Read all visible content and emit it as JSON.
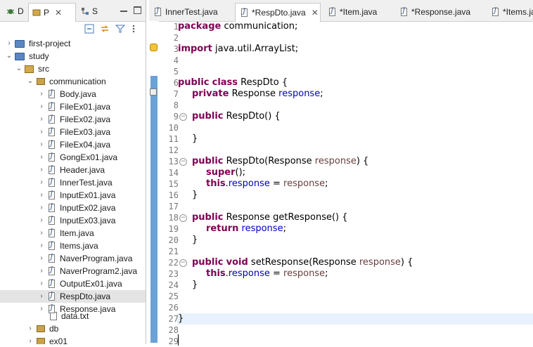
{
  "left_panel": {
    "tabs": [
      {
        "label": "D"
      },
      {
        "label": "P"
      },
      {
        "label": "S"
      }
    ],
    "tree": {
      "projects": [
        {
          "label": "first-project"
        },
        {
          "label": "study"
        }
      ],
      "src": "src",
      "package": "communication",
      "files": [
        "Body.java",
        "FileEx01.java",
        "FileEx02.java",
        "FileEx03.java",
        "FileEx04.java",
        "GongEx01.java",
        "Header.java",
        "InnerTest.java",
        "InputEx01.java",
        "InputEx02.java",
        "InputEx03.java",
        "Item.java",
        "Items.java",
        "NaverProgram.java",
        "NaverProgram2.java",
        "OutputEx01.java",
        "RespDto.java",
        "Response.java"
      ],
      "data_file": "data.txt",
      "other_packages": [
        "db",
        "ex01"
      ]
    }
  },
  "editor": {
    "tabs": [
      {
        "label": "InnerTest.java"
      },
      {
        "label": "*RespDto.java"
      },
      {
        "label": "*Item.java"
      },
      {
        "label": "*Response.java"
      },
      {
        "label": "*Items.ja"
      }
    ],
    "line_numbers": [
      "1",
      "2",
      "3",
      "4",
      "5",
      "6",
      "7",
      "8",
      "9",
      "10",
      "11",
      "12",
      "13",
      "14",
      "15",
      "16",
      "17",
      "18",
      "19",
      "20",
      "21",
      "22",
      "23",
      "24",
      "25",
      "26",
      "27",
      "28",
      "29"
    ]
  },
  "colors": {
    "keyword": "#7f0055",
    "field": "#0000c0",
    "parameter": "#6a3e3e",
    "current_line": "#e8f2fe",
    "change_bar": "#6aa2d8"
  }
}
